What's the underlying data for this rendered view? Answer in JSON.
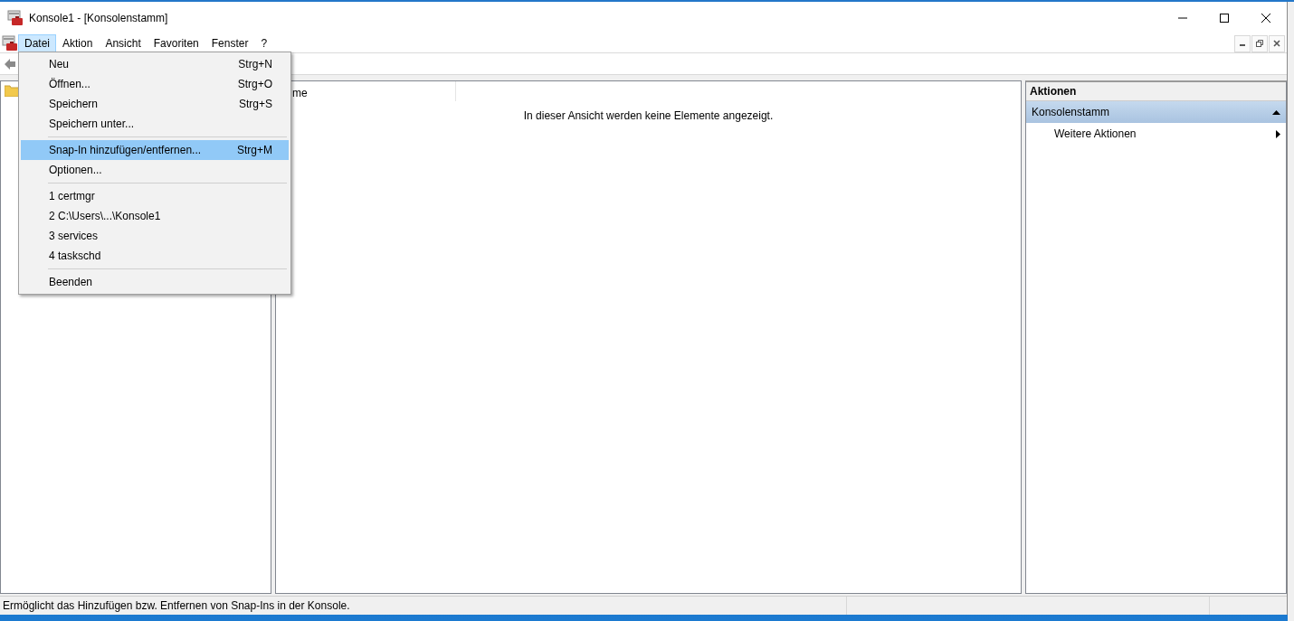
{
  "window": {
    "title": "Konsole1 - [Konsolenstamm]"
  },
  "menubar": [
    {
      "label": "Datei",
      "selected": true
    },
    {
      "label": "Aktion",
      "selected": false
    },
    {
      "label": "Ansicht",
      "selected": false
    },
    {
      "label": "Favoriten",
      "selected": false
    },
    {
      "label": "Fenster",
      "selected": false
    },
    {
      "label": "?",
      "selected": false
    }
  ],
  "file_menu": [
    {
      "kind": "item",
      "label": "Neu",
      "shortcut": "Strg+N",
      "selected": false
    },
    {
      "kind": "item",
      "label": "Öffnen...",
      "shortcut": "Strg+O",
      "selected": false
    },
    {
      "kind": "item",
      "label": "Speichern",
      "shortcut": "Strg+S",
      "selected": false
    },
    {
      "kind": "item",
      "label": "Speichern unter...",
      "selected": false
    },
    {
      "kind": "separator"
    },
    {
      "kind": "item",
      "label": "Snap-In hinzufügen/entfernen...",
      "shortcut": "Strg+M",
      "selected": true
    },
    {
      "kind": "item",
      "label": "Optionen...",
      "selected": false
    },
    {
      "kind": "separator"
    },
    {
      "kind": "item",
      "label": "1 certmgr",
      "selected": false
    },
    {
      "kind": "item",
      "label": "2 C:\\Users\\...\\Konsole1",
      "selected": false
    },
    {
      "kind": "item",
      "label": "3 services",
      "selected": false
    },
    {
      "kind": "item",
      "label": "4 taskschd",
      "selected": false
    },
    {
      "kind": "separator"
    },
    {
      "kind": "item",
      "label": "Beenden",
      "selected": false
    }
  ],
  "list": {
    "columns": [
      "me"
    ],
    "empty_message": "In dieser Ansicht werden keine Elemente angezeigt."
  },
  "actions": {
    "title": "Aktionen",
    "sections": [
      {
        "label": "Konsolenstamm",
        "expanded": true,
        "items": [
          "Weitere Aktionen"
        ]
      }
    ]
  },
  "status_bar": {
    "text": "Ermöglicht das Hinzufügen bzw. Entfernen von Snap-Ins in der Konsole."
  }
}
